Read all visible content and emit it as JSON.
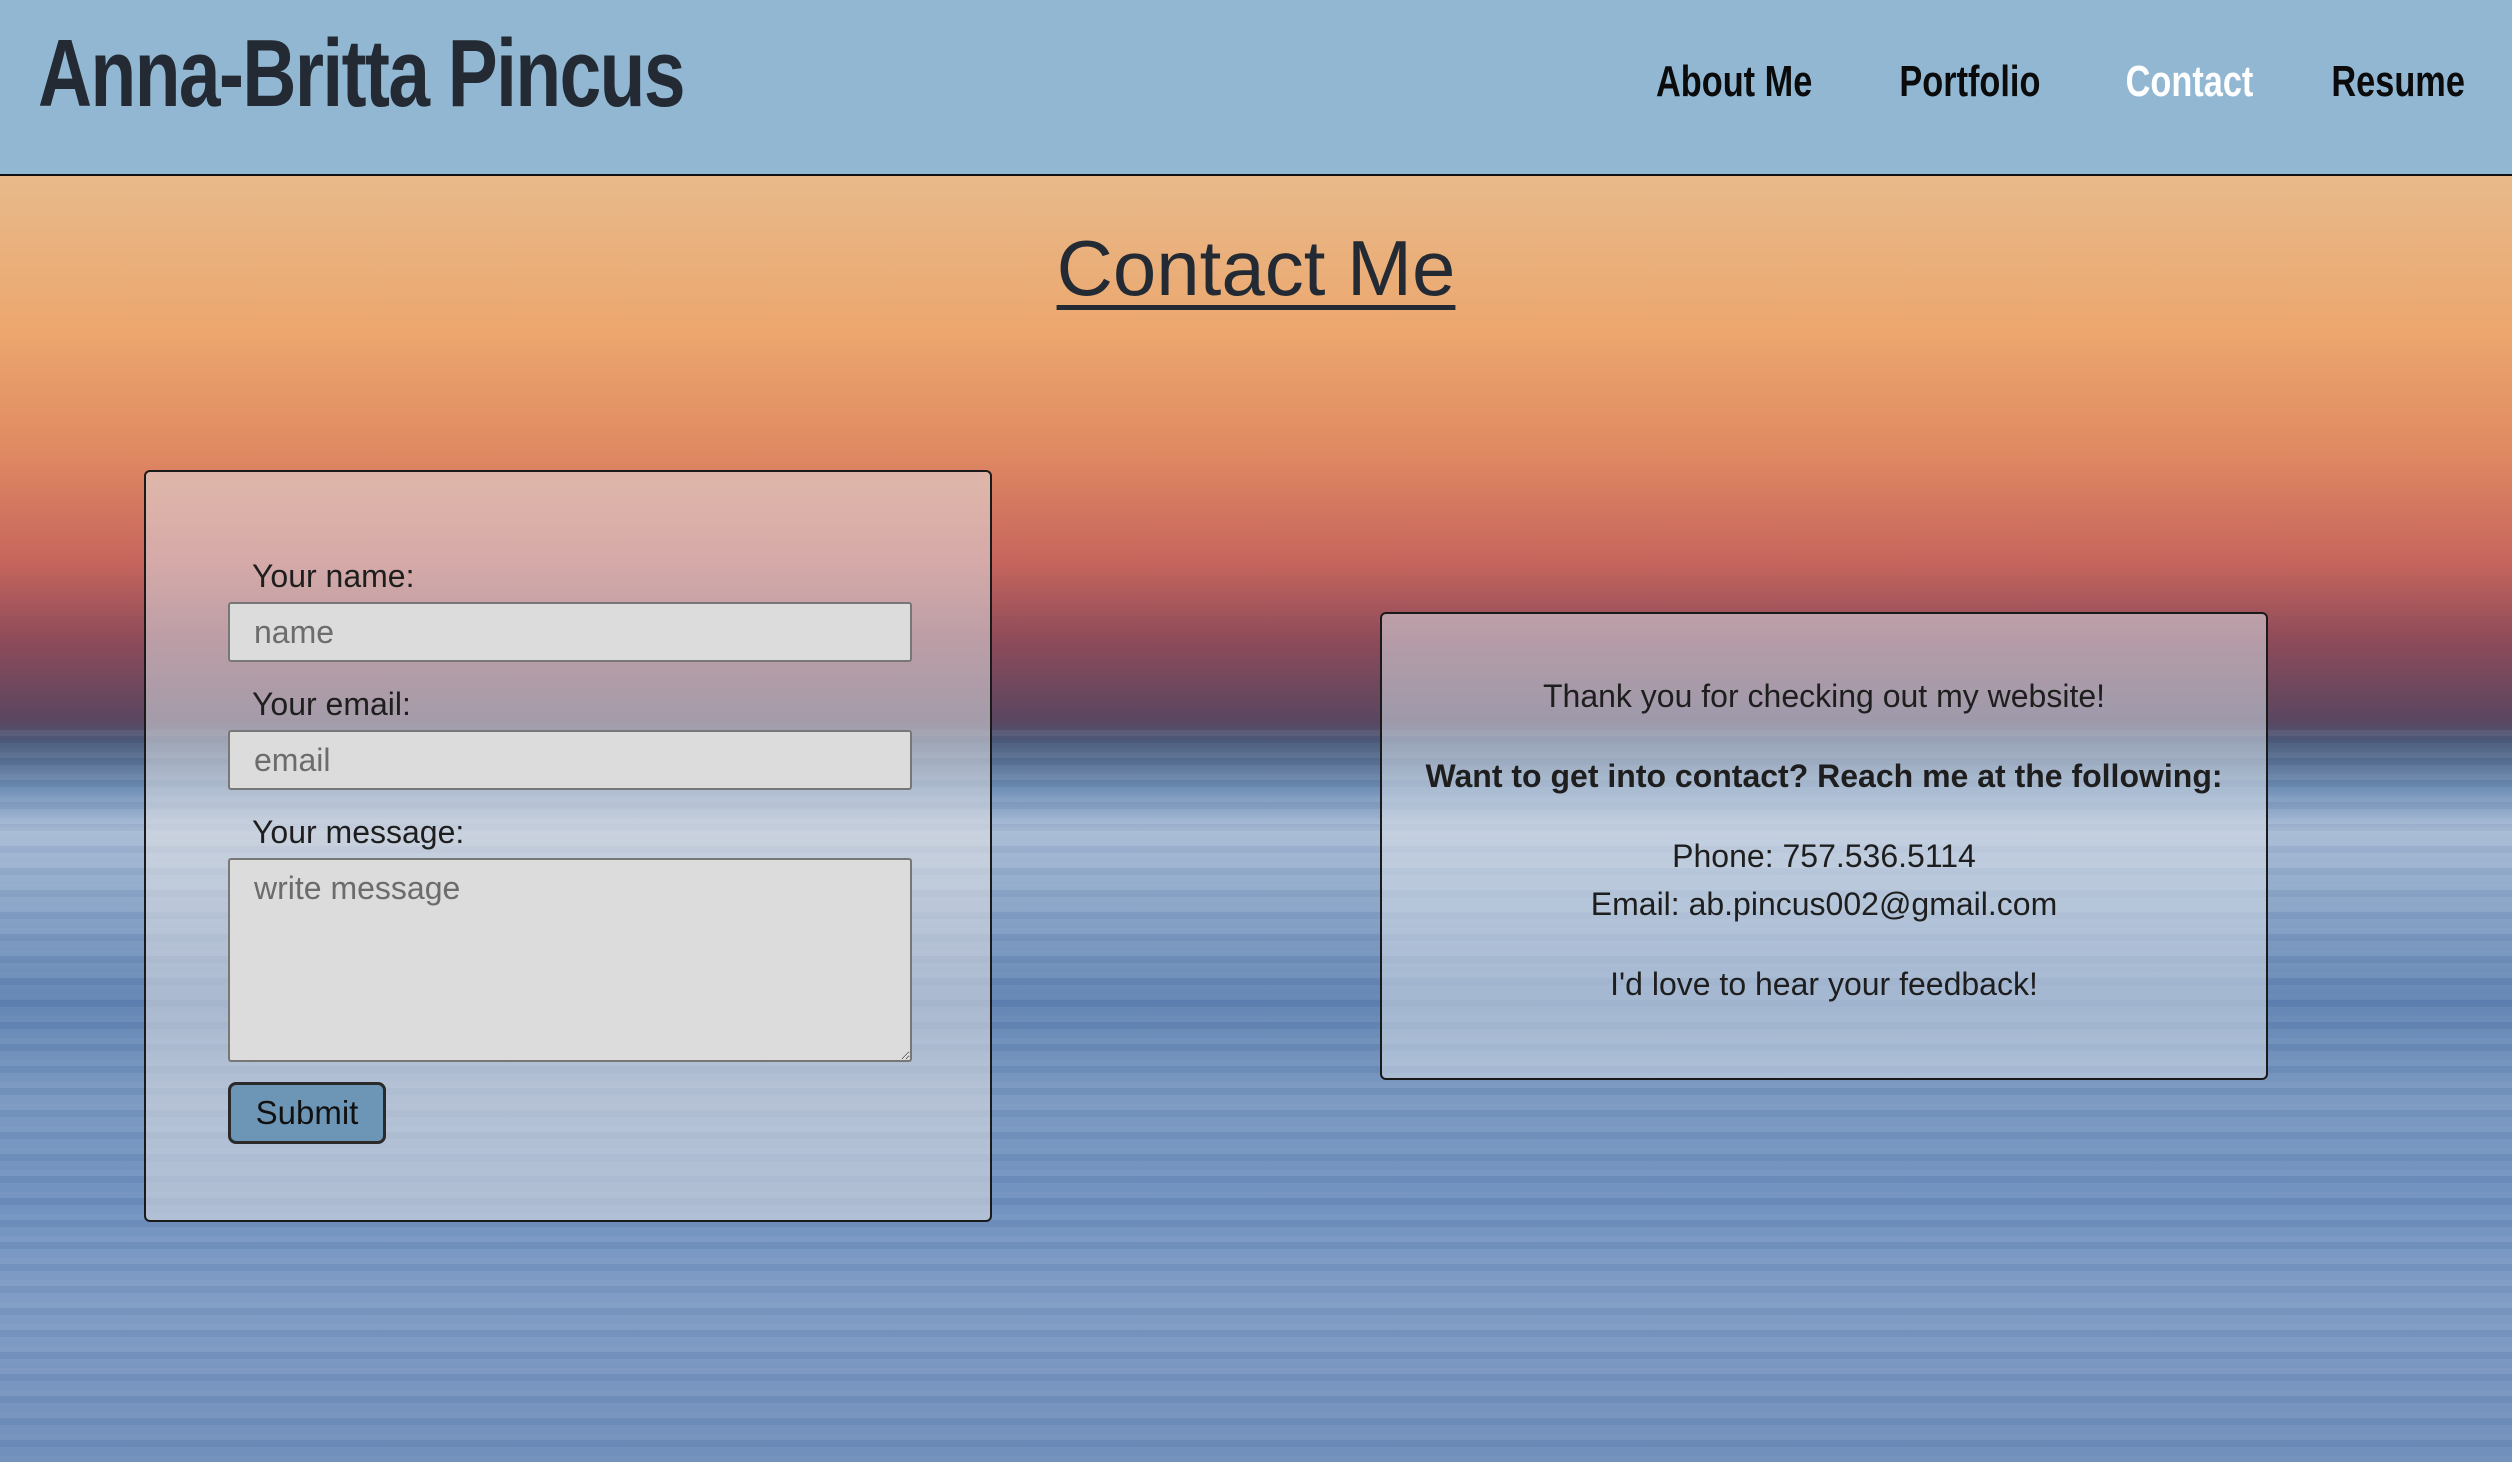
{
  "header": {
    "site_title": "Anna-Britta Pincus",
    "nav": [
      {
        "label": "About Me",
        "active": false
      },
      {
        "label": "Portfolio",
        "active": false
      },
      {
        "label": "Contact",
        "active": true
      },
      {
        "label": "Resume",
        "active": false
      }
    ]
  },
  "main": {
    "heading": "Contact Me"
  },
  "form": {
    "name_label": "Your name:",
    "name_placeholder": "name",
    "name_value": "",
    "email_label": "Your email:",
    "email_placeholder": "email",
    "email_value": "",
    "message_label": "Your message:",
    "message_placeholder": "write message",
    "message_value": "",
    "submit_label": "Submit"
  },
  "info": {
    "thanks": "Thank you for checking out my website!",
    "cta": "Want to get into contact? Reach me at the following:",
    "phone": "Phone: 757.536.5114",
    "email": "Email: ab.pincus002@gmail.com",
    "closing": "I'd love to hear your feedback!"
  },
  "colors": {
    "header_bg": "#91b7d3",
    "nav_active": "#ffffff",
    "nav_text": "#0b0b0b",
    "submit_bg": "#6d95b6"
  }
}
